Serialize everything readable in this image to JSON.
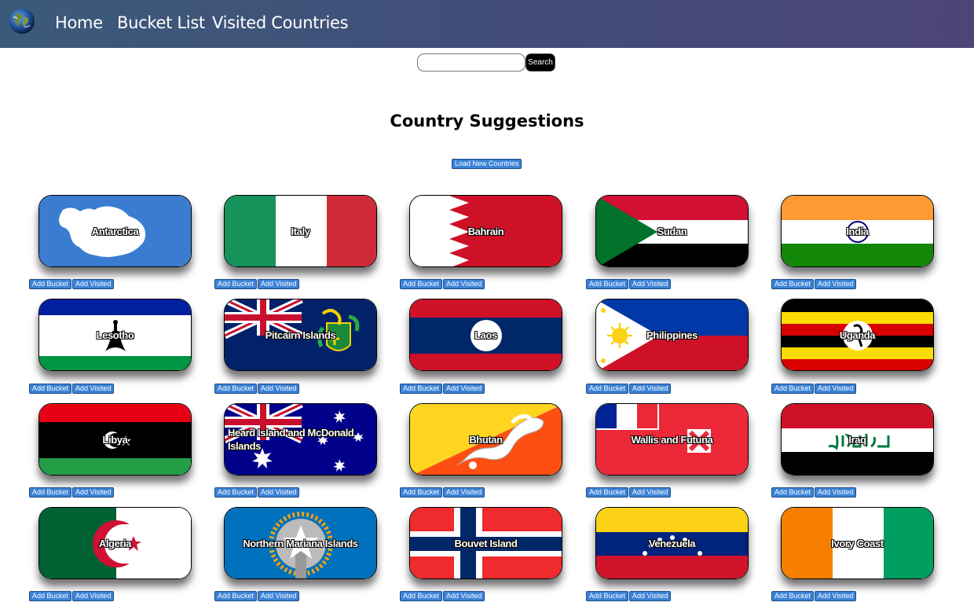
{
  "nav": {
    "logo_icon": "earth-globe-icon",
    "links": [
      "Home",
      "Bucket List",
      "Visited Countries"
    ]
  },
  "search": {
    "value": "",
    "placeholder": "",
    "button_label": "Search"
  },
  "main": {
    "title": "Country Suggestions",
    "load_button": "Load New Countries",
    "add_bucket_label": "Add Bucket",
    "add_visited_label": "Add Visited"
  },
  "countries": [
    "Antarctica",
    "Italy",
    "Bahrain",
    "Sudan",
    "India",
    "Lesotho",
    "Pitcairn Islands",
    "Laos",
    "Philippines",
    "Uganda",
    "Libya",
    "Heard Island and McDonald Islands",
    "Bhutan",
    "Wallis and Futuna",
    "Iraq",
    "Algeria",
    "Northern Mariana Islands",
    "Bouvet Island",
    "Venezuela",
    "Ivory Coast"
  ],
  "colors": {
    "nav_gradient_start": "#3b5a7a",
    "nav_gradient_end": "#4d4478",
    "button_blue": "#3a82d6"
  }
}
